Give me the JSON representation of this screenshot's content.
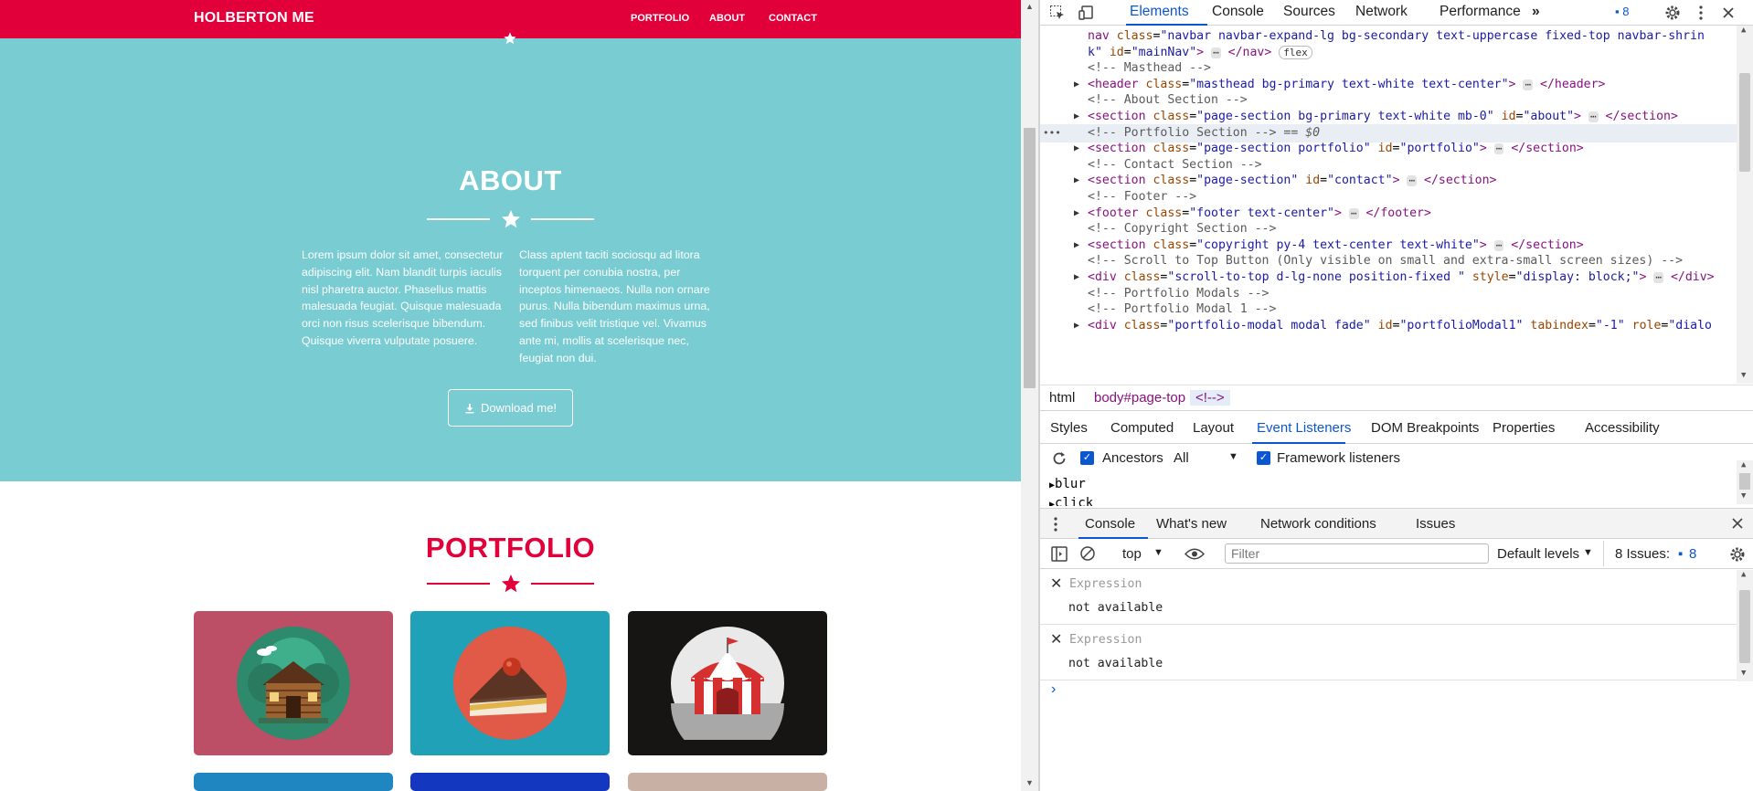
{
  "site": {
    "brand": "HOLBERTON ME",
    "nav": {
      "portfolio": "PORTFOLIO",
      "about": "ABOUT",
      "contact": "CONTACT"
    },
    "about": {
      "title": "ABOUT",
      "col1": "Lorem ipsum dolor sit amet, consectetur adipiscing elit. Nam blandit turpis iaculis nisl pharetra auctor. Phasellus mattis malesuada feugiat. Quisque malesuada orci non risus scelerisque bibendum. Quisque viverra vulputate posuere.",
      "col2": "Class aptent taciti sociosqu ad litora torquent per conubia nostra, per inceptos himenaeos. Nulla non ornare purus. Nulla bibendum maximus urna, sed finibus velit tristique vel. Vivamus ante mi, mollis at scelerisque nec, feugiat non dui.",
      "download": "Download me!"
    },
    "portfolio": {
      "title": "PORTFOLIO",
      "tiles": [
        {
          "bg": "#bc4e66",
          "icon": "cabin-icon"
        },
        {
          "bg": "#20a1b7",
          "icon": "cake-icon"
        },
        {
          "bg": "#171414",
          "icon": "circus-tent-icon"
        },
        {
          "bg": "#1f86c1",
          "icon": ""
        },
        {
          "bg": "#1338bf",
          "icon": ""
        },
        {
          "bg": "#c8b0a4",
          "icon": ""
        }
      ]
    },
    "colors": {
      "brand": "#e1003a",
      "about_bg": "#79ccd1"
    }
  },
  "devtools": {
    "tabs": [
      "Elements",
      "Console",
      "Sources",
      "Network",
      "Performance"
    ],
    "more": "»",
    "issues_count": "8",
    "dom_lines": [
      {
        "html": "<span class='tag'>nav</span> <span class='attr'>class</span>=<span class='val'>\"navbar navbar-expand-lg bg-secondary text-uppercase fixed-top navbar-shrin</span>",
        "tri": false,
        "indent": 1
      },
      {
        "html": "<span class='val'>k\"</span> <span class='attr'>id</span>=<span class='val'>\"mainNav\"</span><span class='tag'>&gt;</span> <span class='ell'>⋯</span> <span class='tag'>&lt;/nav&gt;</span> <span class='pill'>flex</span>",
        "tri": false,
        "indent": 1
      },
      {
        "html": "<span class='cmt'>&lt;!-- Masthead --&gt;</span>",
        "tri": false,
        "indent": 1
      },
      {
        "html": "<span class='tag'>&lt;header</span> <span class='attr'>class</span>=<span class='val'>\"masthead bg-primary text-white text-center\"</span><span class='tag'>&gt;</span> <span class='ell'>⋯</span> <span class='tag'>&lt;/header&gt;</span>",
        "tri": true,
        "indent": 1
      },
      {
        "html": "<span class='cmt'>&lt;!-- About Section --&gt;</span>",
        "tri": false,
        "indent": 1
      },
      {
        "html": "<span class='tag'>&lt;section</span> <span class='attr'>class</span>=<span class='val'>\"page-section bg-primary text-white mb-0\"</span> <span class='attr'>id</span>=<span class='val'>\"about\"</span><span class='tag'>&gt;</span> <span class='ell'>⋯</span> <span class='tag'>&lt;/section&gt;</span>",
        "tri": true,
        "indent": 1
      },
      {
        "html": "<span class='cmt'>&lt;!-- Portfolio Section --&gt;</span> <span class='cmt'>== <i>$0</i></span>",
        "tri": false,
        "indent": 1,
        "selected": true
      },
      {
        "html": "<span class='tag'>&lt;section</span> <span class='attr'>class</span>=<span class='val'>\"page-section portfolio\"</span> <span class='attr'>id</span>=<span class='val'>\"portfolio\"</span><span class='tag'>&gt;</span> <span class='ell'>⋯</span> <span class='tag'>&lt;/section&gt;</span>",
        "tri": true,
        "indent": 1
      },
      {
        "html": "<span class='cmt'>&lt;!-- Contact Section --&gt;</span>",
        "tri": false,
        "indent": 1
      },
      {
        "html": "<span class='tag'>&lt;section</span> <span class='attr'>class</span>=<span class='val'>\"page-section\"</span> <span class='attr'>id</span>=<span class='val'>\"contact\"</span><span class='tag'>&gt;</span> <span class='ell'>⋯</span> <span class='tag'>&lt;/section&gt;</span>",
        "tri": true,
        "indent": 1
      },
      {
        "html": "<span class='cmt'>&lt;!-- Footer --&gt;</span>",
        "tri": false,
        "indent": 1
      },
      {
        "html": "<span class='tag'>&lt;footer</span> <span class='attr'>class</span>=<span class='val'>\"footer text-center\"</span><span class='tag'>&gt;</span> <span class='ell'>⋯</span> <span class='tag'>&lt;/footer&gt;</span>",
        "tri": true,
        "indent": 1
      },
      {
        "html": "<span class='cmt'>&lt;!-- Copyright Section --&gt;</span>",
        "tri": false,
        "indent": 1
      },
      {
        "html": "<span class='tag'>&lt;section</span> <span class='attr'>class</span>=<span class='val'>\"copyright py-4 text-center text-white\"</span><span class='tag'>&gt;</span> <span class='ell'>⋯</span> <span class='tag'>&lt;/section&gt;</span>",
        "tri": true,
        "indent": 1
      },
      {
        "html": "<span class='cmt'>&lt;!-- Scroll to Top Button (Only visible on small and extra-small screen sizes) --&gt;</span>",
        "tri": false,
        "indent": 1
      },
      {
        "html": "<span class='tag'>&lt;div</span> <span class='attr'>class</span>=<span class='val'>\"scroll-to-top d-lg-none position-fixed \"</span> <span class='attr'>style</span>=<span class='val'>\"display: block;\"</span><span class='tag'>&gt;</span> <span class='ell'>⋯</span> <span class='tag'>&lt;/div&gt;</span>",
        "tri": true,
        "indent": 1
      },
      {
        "html": "<span class='cmt'>&lt;!-- Portfolio Modals --&gt;</span>",
        "tri": false,
        "indent": 1
      },
      {
        "html": "<span class='cmt'>&lt;!-- Portfolio Modal 1 --&gt;</span>",
        "tri": false,
        "indent": 1
      },
      {
        "html": "<span class='tag'>&lt;div</span> <span class='attr'>class</span>=<span class='val'>\"portfolio-modal modal fade\"</span> <span class='attr'>id</span>=<span class='val'>\"portfolioModal1\"</span> <span class='attr'>tabindex</span>=<span class='val'>\"-1\"</span> <span class='attr'>role</span>=<span class='val'>\"dialo</span>",
        "tri": true,
        "indent": 1
      }
    ],
    "breadcrumbs": {
      "html": "html",
      "body": "body#page-top",
      "comment": "<!-->"
    },
    "sub_tabs": [
      "Styles",
      "Computed",
      "Layout",
      "Event Listeners",
      "DOM Breakpoints",
      "Properties",
      "Accessibility"
    ],
    "listener_bar": {
      "ancestors": "Ancestors",
      "scope": "All",
      "framework": "Framework listeners"
    },
    "listeners": [
      "blur",
      "click"
    ],
    "drawer_tabs": [
      "Console",
      "What's new",
      "Network conditions",
      "Issues"
    ],
    "console_toolbar": {
      "context": "top",
      "filter_placeholder": "Filter",
      "levels": "Default levels",
      "issues": "8 Issues:",
      "issues_count": "8"
    },
    "expressions": [
      {
        "label": "Expression",
        "value": "not available"
      },
      {
        "label": "Expression",
        "value": "not available"
      }
    ],
    "prompt": "›"
  }
}
